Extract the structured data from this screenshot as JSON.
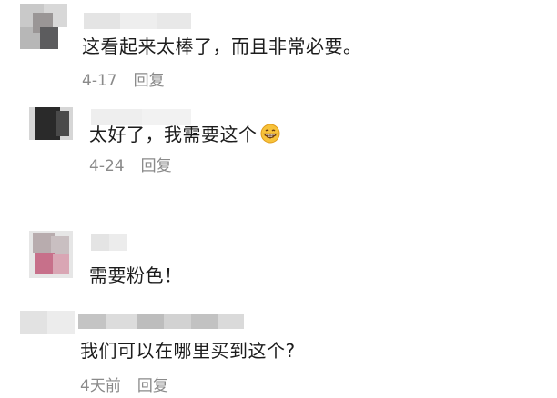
{
  "colors": {
    "text": "#1c1c1c",
    "meta": "#8a8a8a",
    "background": "#ffffff"
  },
  "comments": [
    {
      "text": "这看起来太棒了，而且非常必要。",
      "date": "4-17",
      "reply_label": "回复"
    },
    {
      "text": "太好了，我需要这个",
      "emoji": "grinning-face-emoji",
      "date": "4-24",
      "reply_label": "回复"
    },
    {
      "text": "需要粉色！"
    },
    {
      "text": "我们可以在哪里买到这个?",
      "date": "4天前",
      "reply_label": "回复"
    }
  ]
}
